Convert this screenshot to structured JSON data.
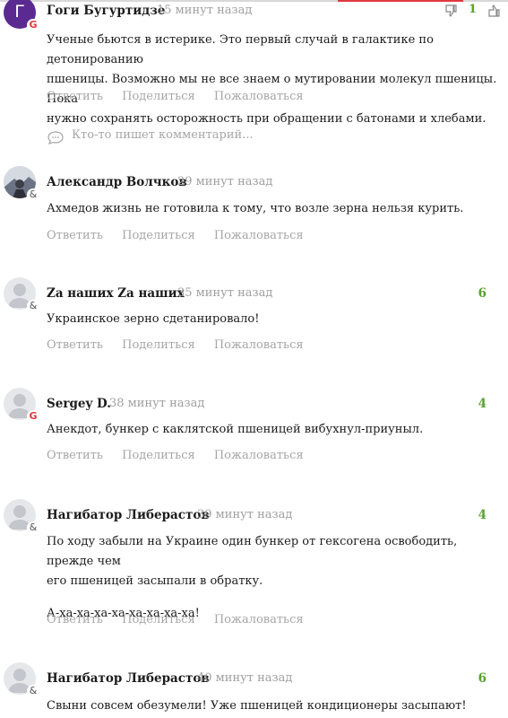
{
  "actions": {
    "reply": "Ответить",
    "share": "Поделиться",
    "report": "Пожаловаться"
  },
  "typing_indicator": "Кто-то пишет комментарий...",
  "comments": [
    {
      "author": "Гоги Бугуртидзе",
      "time": "15 минут назад",
      "avatar_initial": "Г",
      "avatar_badge": "G",
      "score": "1",
      "text": [
        "Ученые бьются в истерике. Это первый случай в галактике по детонированию",
        "пшеницы. Возможно мы не все знаем о мутировании молекул пшеницы. Пока",
        "нужно сохранять осторожность при обращении с батонами и хлебами."
      ]
    },
    {
      "author": "Александр Волчков",
      "time": "29 минут назад",
      "avatar_badge": "&",
      "score": "",
      "text": [
        "Ахмедов жизнь не готовила к тому, что возле зерна нельзя курить."
      ]
    },
    {
      "author": "Za наших Za наших",
      "time": "35 минут назад",
      "avatar_badge": "&",
      "score": "6",
      "text": [
        "Украинское зерно сдетанировало!"
      ]
    },
    {
      "author": "Sergey D.",
      "time": "38 минут назад",
      "avatar_badge": "G",
      "score": "4",
      "text": [
        "Анекдот, бункер с каклятской пшеницей вибухнул-приуныл."
      ]
    },
    {
      "author": "Нагибатор Либерастов",
      "time": "39 минут назад",
      "avatar_badge": "&",
      "score": "4",
      "text": [
        "По ходу забыли на Украине один бункер от гексогена освободить, прежде чем",
        "его пшеницей засыпали в обратку.",
        "",
        "А-ха-ха-ха-ха-ха-ха-ха-ха!"
      ]
    },
    {
      "author": "Нагибатор Либерастов",
      "time": "40 минут назад",
      "avatar_badge": "&",
      "score": "6",
      "text": [
        "Свыни совсем обезумели! Уже пшеницей кондиционеры засыпают!"
      ]
    }
  ],
  "colors": {
    "score_green": "#5aa132",
    "muted": "#a6a6a6",
    "avatar_purple": "#5b2a91",
    "google_red": "#e0393e"
  }
}
